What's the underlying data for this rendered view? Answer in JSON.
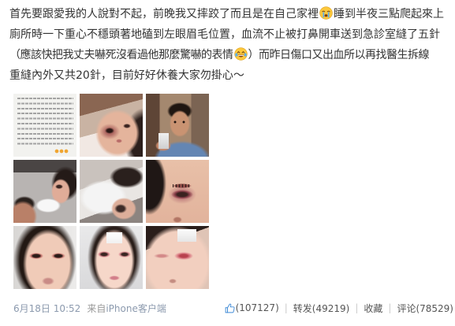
{
  "post": {
    "lines": [
      [
        "首先要跟愛我的人說對不起，前晚我又摔跤了而且是在自己家裡",
        "睡到半夜三點爬起來上"
      ],
      [
        "廁所時一下重心不穩頭著地磕到左眼眉毛位置，血流不止被打鼻開車送到急診室縫了五針"
      ],
      [
        "（應該快把我丈夫嚇死沒看過他那麼驚嚇的表情",
        "）而昨日傷口又出血所以再找醫生拆線"
      ],
      [
        "重縫內外又共20針，目前好好休養大家勿掛心～"
      ]
    ],
    "emoji_icons": [
      "crying-face-icon",
      "tears-of-joy-icon"
    ]
  },
  "footer": {
    "date": "6月18日 10:52",
    "from_label": "来自",
    "source": "iPhone客户端",
    "like_icon": "thumbs-up-icon",
    "like_count": "(107127)",
    "separator": "|",
    "repost": "转发(49219)",
    "favorite": "收藏",
    "comment": "评论(78529)"
  },
  "theme": {
    "body_text": "#333333",
    "meta_text": "#999999",
    "meta_link": "#8c9aae",
    "action_text": "#555555",
    "separator": "#cccccc",
    "like_icon": "#3f8ad6"
  }
}
